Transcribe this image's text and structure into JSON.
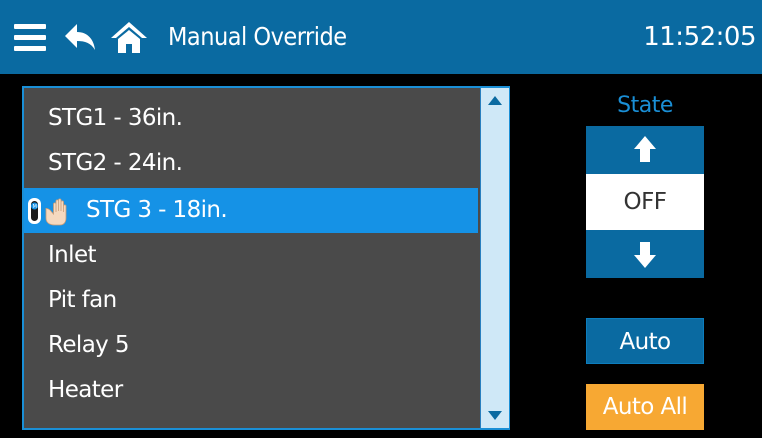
{
  "header": {
    "title": "Manual Override",
    "clock": "11:52:05",
    "background_color": "#0a6aa1",
    "icons": [
      "menu-icon",
      "back-arrow-icon",
      "home-icon"
    ]
  },
  "list": {
    "items": [
      {
        "label": "STG1 - 36in.",
        "selected": false
      },
      {
        "label": "STG2 - 24in.",
        "selected": false
      },
      {
        "label": "STG 3 - 18in.",
        "selected": true,
        "icons": [
          "manual-mode-icon",
          "hand-icon"
        ]
      },
      {
        "label": "Inlet",
        "selected": false
      },
      {
        "label": "Pit fan",
        "selected": false
      },
      {
        "label": "Relay 5",
        "selected": false
      },
      {
        "label": "Heater",
        "selected": false
      }
    ],
    "selected_color": "#1592e6",
    "background_color": "#4a4a4a"
  },
  "state_panel": {
    "label": "State",
    "value": "OFF",
    "icons": [
      "arrow-up-icon",
      "arrow-down-icon"
    ]
  },
  "buttons": {
    "auto_label": "Auto",
    "auto_all_label": "Auto All",
    "auto_all_color": "#f7a833"
  }
}
